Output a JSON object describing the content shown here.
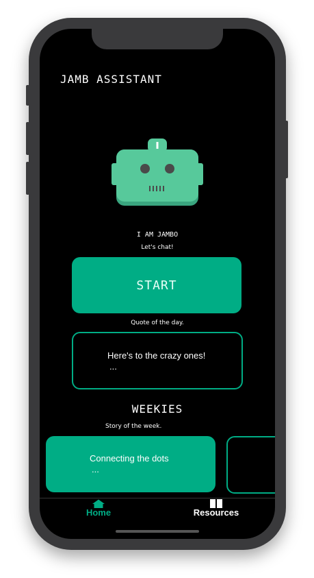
{
  "app": {
    "title": "JAMB ASSISTANT"
  },
  "bot": {
    "name": "I AM JAMBO",
    "subtitle": "Let's chat!"
  },
  "start_button": {
    "label": "START"
  },
  "quote": {
    "heading": "Quote of the day.",
    "text": "Here's to the crazy ones!",
    "ellipsis": "..."
  },
  "weekies": {
    "title": "WEEKIES",
    "subtitle": "Story of the week.",
    "story_title": "Connecting the dots",
    "ellipsis": "..."
  },
  "tabs": [
    {
      "label": "Home",
      "icon": "home-icon",
      "active": true
    },
    {
      "label": "Resources",
      "icon": "book-icon",
      "active": false
    }
  ],
  "colors": {
    "accent": "#00ad85",
    "robot": "#57c99b",
    "background": "#000000"
  }
}
